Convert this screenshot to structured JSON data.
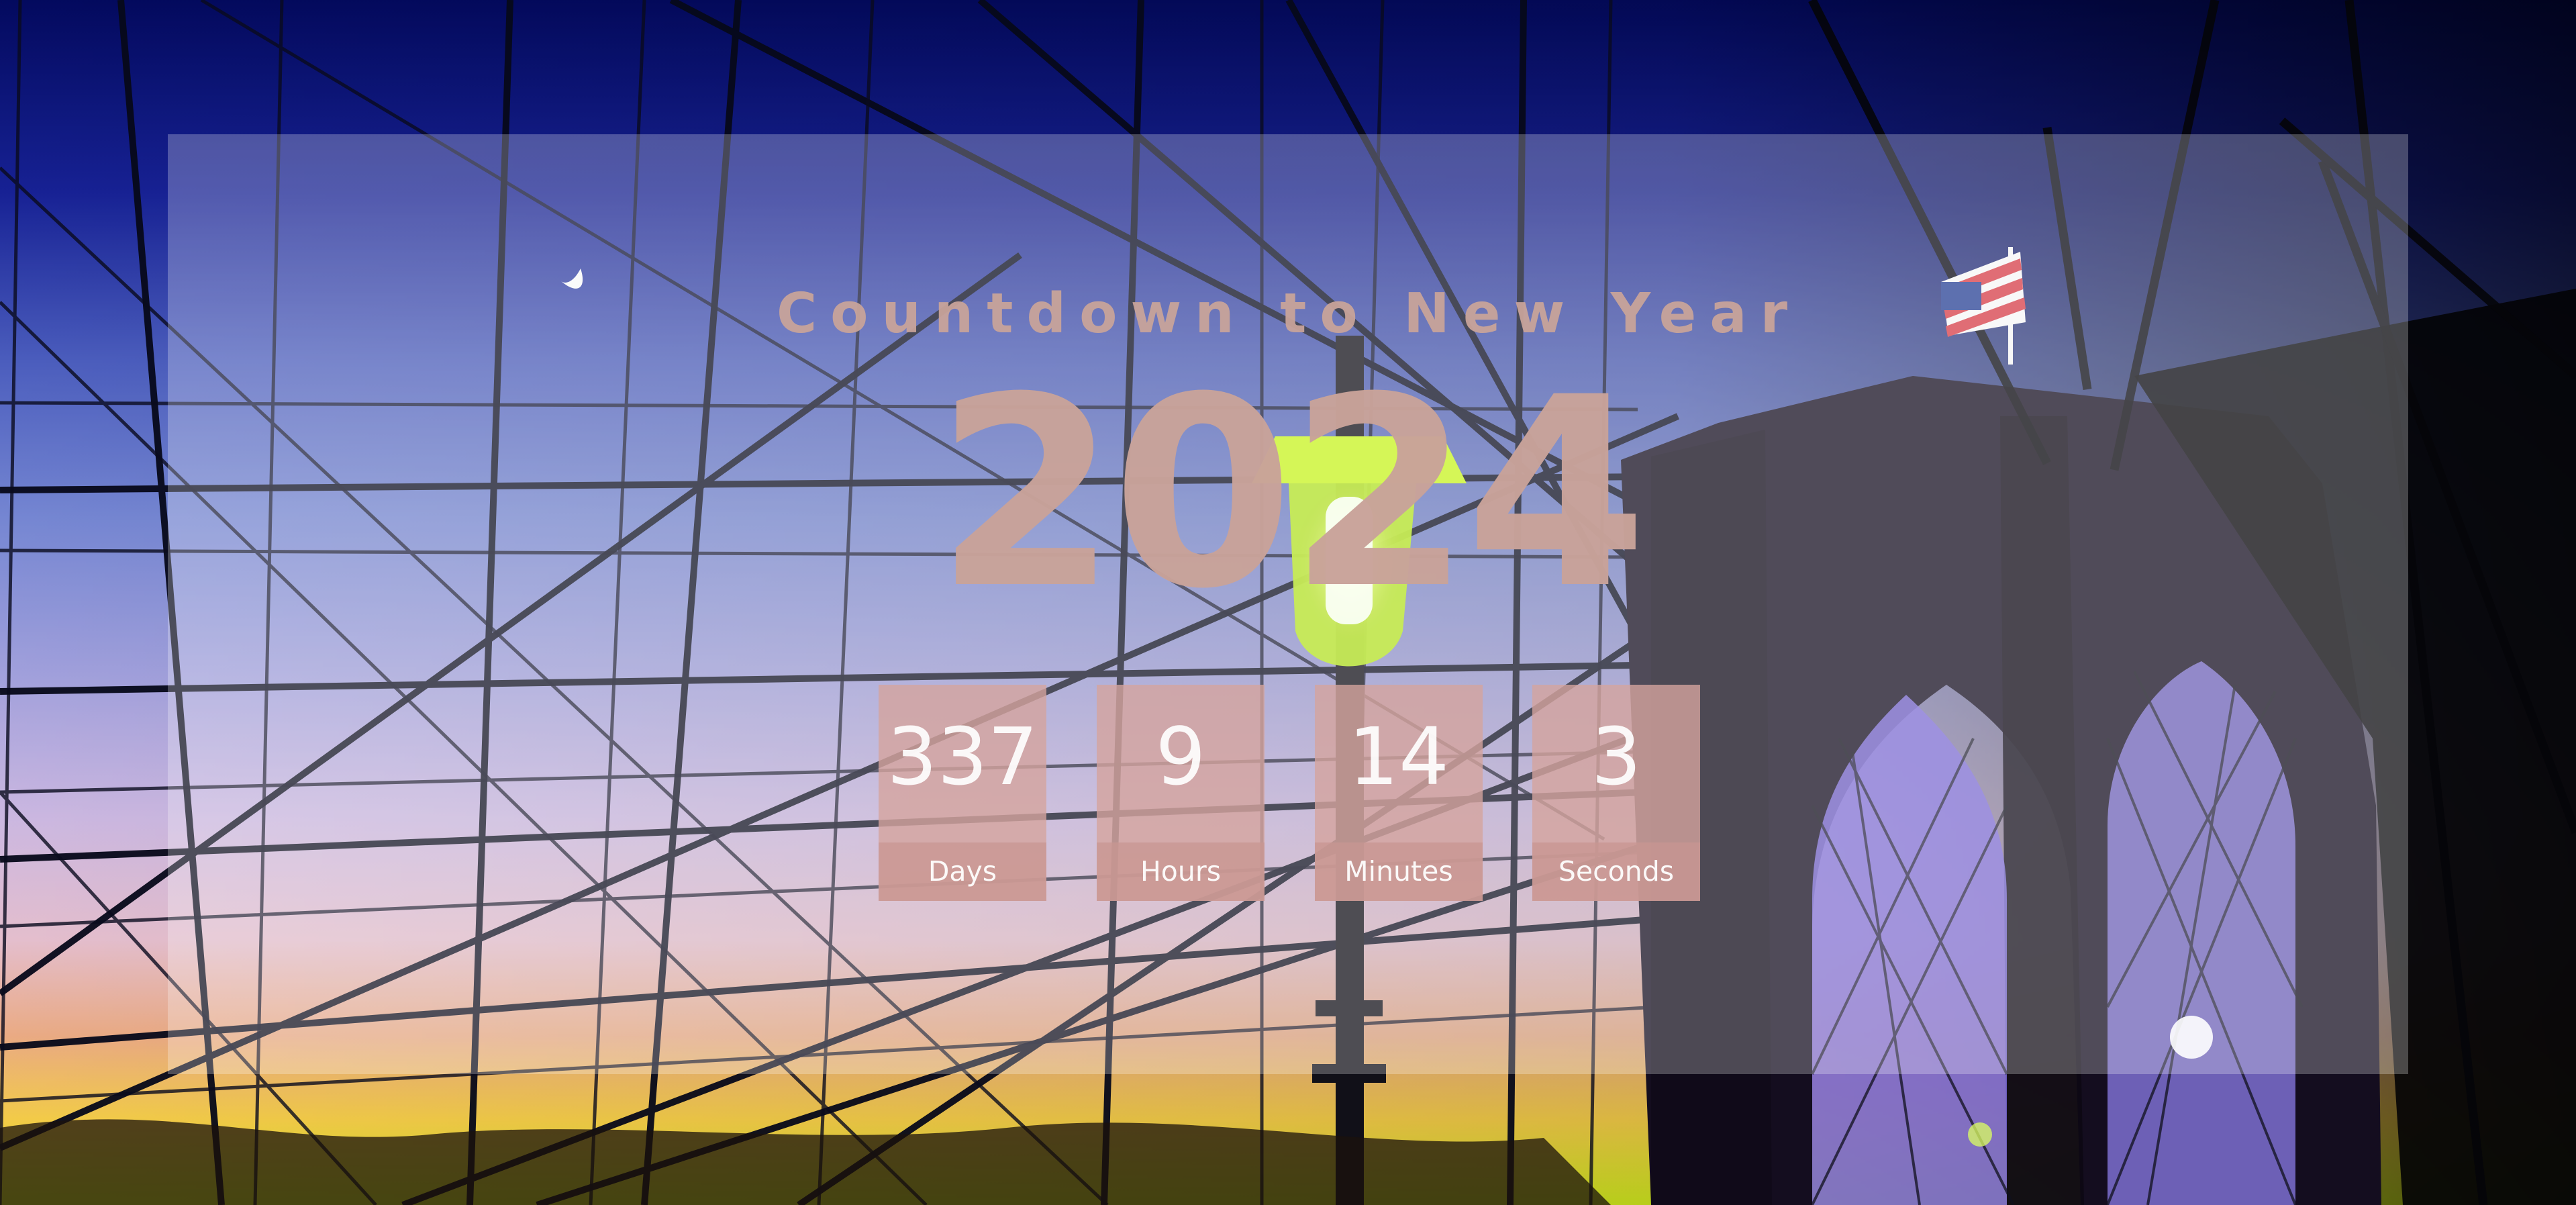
{
  "page": {
    "title": "Countdown to New Year",
    "year": "2024",
    "colors": {
      "overlay": "#d6a39c",
      "text": "#ffffff",
      "title": "#c9a49a"
    }
  },
  "countdown": {
    "days": {
      "value": "337",
      "label": "Days"
    },
    "hours": {
      "value": "9",
      "label": "Hours"
    },
    "minutes": {
      "value": "14",
      "label": "Minutes"
    },
    "seconds": {
      "value": "3",
      "label": "Seconds"
    }
  }
}
